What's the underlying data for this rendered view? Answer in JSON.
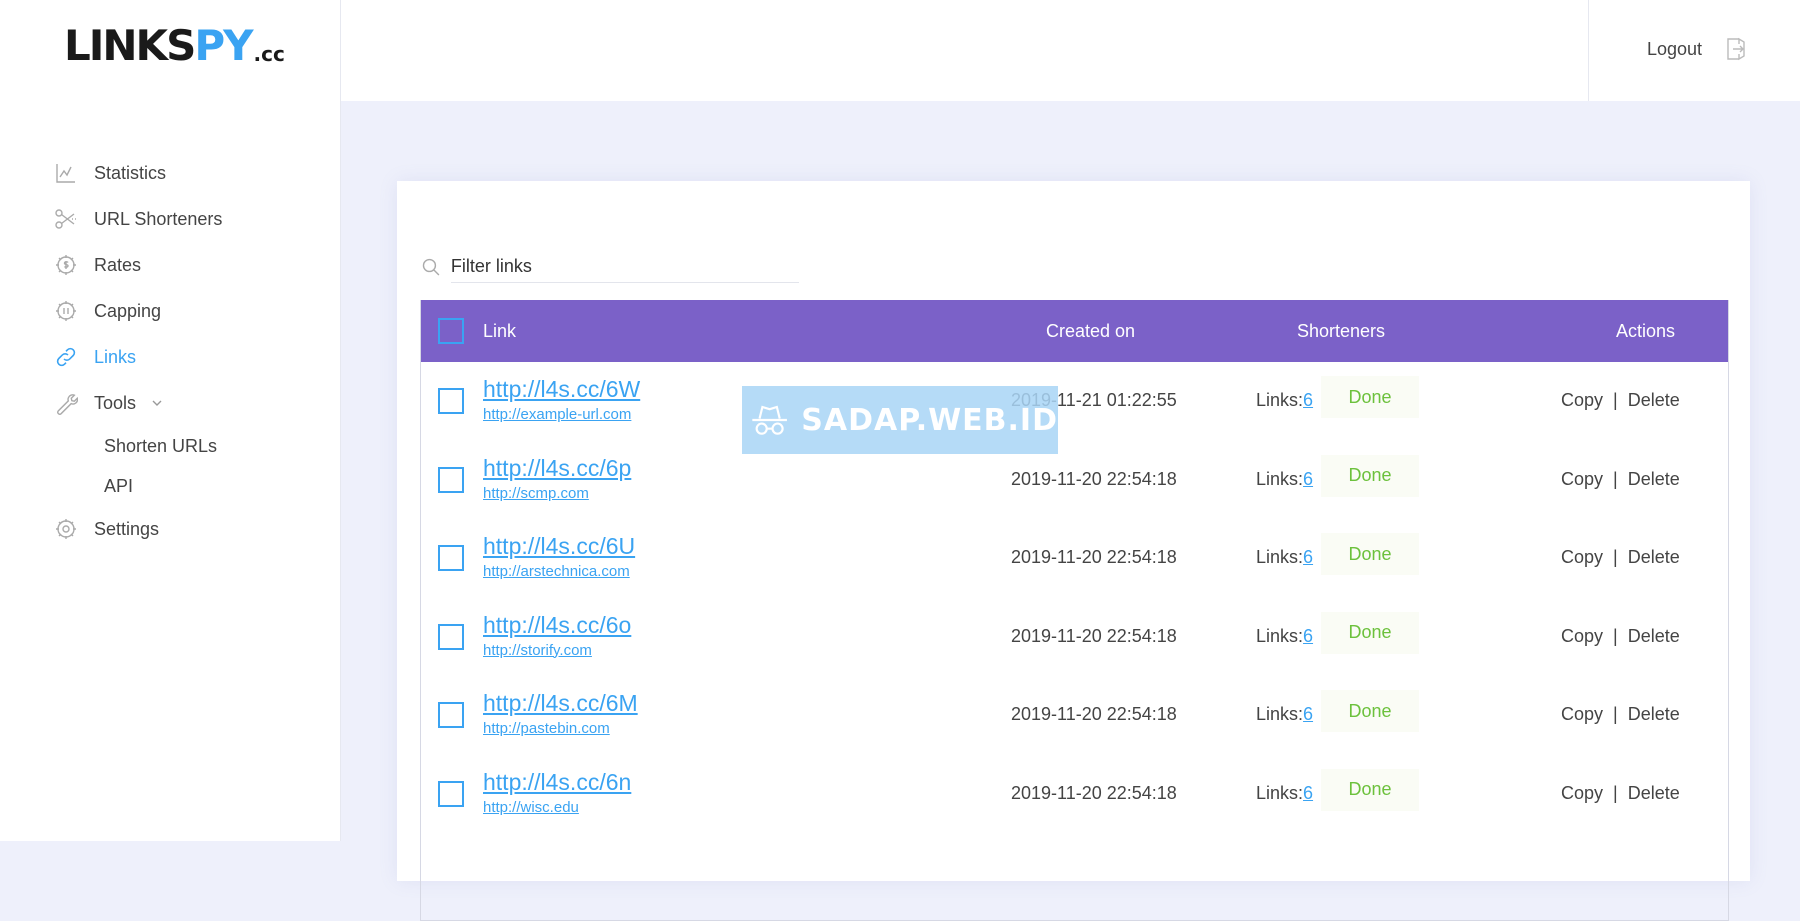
{
  "brand": {
    "logo_part1": "LINKS",
    "logo_part2": "PY",
    "logo_suffix": ".cc",
    "accent": "#3aa3f2"
  },
  "sidebar": {
    "items": [
      {
        "label": "Statistics",
        "icon": "chart-line-icon"
      },
      {
        "label": "URL Shorteners",
        "icon": "scissors-icon"
      },
      {
        "label": "Rates",
        "icon": "gear-dollar-icon"
      },
      {
        "label": "Capping",
        "icon": "gear-pause-icon"
      },
      {
        "label": "Links",
        "icon": "link-icon",
        "active": true
      },
      {
        "label": "Tools",
        "icon": "wrench-icon",
        "expanded": true,
        "children": [
          {
            "label": "Shorten URLs"
          },
          {
            "label": "API"
          }
        ]
      },
      {
        "label": "Settings",
        "icon": "gear-icon"
      }
    ]
  },
  "header": {
    "logout_label": "Logout"
  },
  "filter": {
    "placeholder": "Filter links"
  },
  "table": {
    "header_color": "#7b61c8",
    "columns": {
      "link": "Link",
      "created": "Created on",
      "shorteners": "Shorteners",
      "actions": "Actions"
    },
    "rows": [
      {
        "short": "http://l4s.cc/6W",
        "original": "http://example-url.com",
        "created": "2019-11-21 01:22:55",
        "links_label": "Links:",
        "links_count": "6",
        "status": "Done",
        "copy": "Copy",
        "sep": "|",
        "delete": "Delete"
      },
      {
        "short": "http://l4s.cc/6p",
        "original": "http://scmp.com",
        "created": "2019-11-20 22:54:18",
        "links_label": "Links:",
        "links_count": "6",
        "status": "Done",
        "copy": "Copy",
        "sep": "|",
        "delete": "Delete"
      },
      {
        "short": "http://l4s.cc/6U",
        "original": "http://arstechnica.com",
        "created": "2019-11-20 22:54:18",
        "links_label": "Links:",
        "links_count": "6",
        "status": "Done",
        "copy": "Copy",
        "sep": "|",
        "delete": "Delete"
      },
      {
        "short": "http://l4s.cc/6o",
        "original": "http://storify.com",
        "created": "2019-11-20 22:54:18",
        "links_label": "Links:",
        "links_count": "6",
        "status": "Done",
        "copy": "Copy",
        "sep": "|",
        "delete": "Delete"
      },
      {
        "short": "http://l4s.cc/6M",
        "original": "http://pastebin.com",
        "created": "2019-11-20 22:54:18",
        "links_label": "Links:",
        "links_count": "6",
        "status": "Done",
        "copy": "Copy",
        "sep": "|",
        "delete": "Delete"
      },
      {
        "short": "http://l4s.cc/6n",
        "original": "http://wisc.edu",
        "created": "2019-11-20 22:54:18",
        "links_label": "Links:",
        "links_count": "6",
        "status": "Done",
        "copy": "Copy",
        "sep": "|",
        "delete": "Delete"
      }
    ]
  },
  "watermark": {
    "text": "SADAP.WEB.ID"
  }
}
